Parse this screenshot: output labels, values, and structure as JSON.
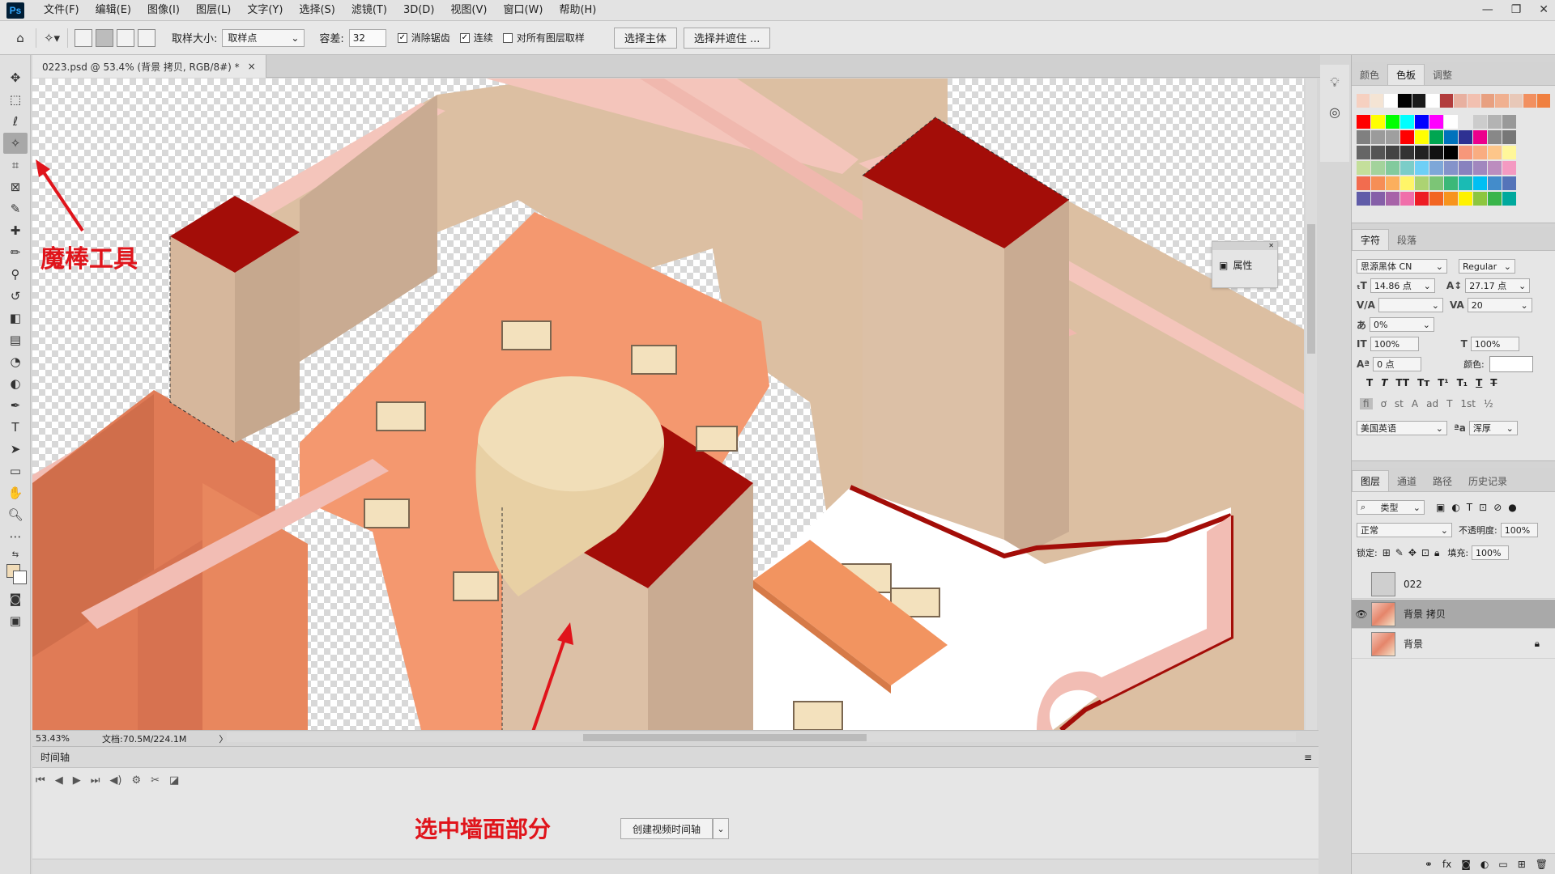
{
  "menubar": {
    "logo": "Ps",
    "items": [
      "文件(F)",
      "编辑(E)",
      "图像(I)",
      "图层(L)",
      "文字(Y)",
      "选择(S)",
      "滤镜(T)",
      "3D(D)",
      "视图(V)",
      "窗口(W)",
      "帮助(H)"
    ],
    "window_controls": [
      "—",
      "❐",
      "✕"
    ]
  },
  "optionsbar": {
    "sample_size_label": "取样大小:",
    "sample_size_value": "取样点",
    "tolerance_label": "容差:",
    "tolerance_value": "32",
    "antialias_label": "消除锯齿",
    "antialias_checked": true,
    "contiguous_label": "连续",
    "contiguous_checked": true,
    "all_layers_label": "对所有图层取样",
    "all_layers_checked": false,
    "select_subject": "选择主体",
    "select_and_mask": "选择并遮住 ..."
  },
  "document": {
    "tab_title": "0223.psd @ 53.4% (背景 拷贝, RGB/8#) *",
    "close": "×",
    "zoom": "53.43%",
    "doc_size": "文档:70.5M/224.1M",
    "arrow": "〉"
  },
  "timeline": {
    "title": "时间轴",
    "create_button": "创建视频时间轴",
    "controls": [
      "⏮",
      "◀",
      "▶",
      "⏭",
      "◀)",
      "⚙",
      "✂",
      "◪"
    ]
  },
  "properties_panel": {
    "label": "属性"
  },
  "swatches": {
    "tabs": [
      "颜色",
      "色板",
      "调整"
    ],
    "active_tab": "色板",
    "rows": [
      [
        "#f6d0c0",
        "#f4e4d4",
        "#ffffff",
        "#000000",
        "#1a1a1a",
        "#ffffff",
        "#b23c3c",
        "#e8b0a0",
        "#f2c0b0",
        "#e8a080",
        "#f0b090",
        "#e8c8b8",
        "#f29060",
        "#f08040"
      ],
      [
        "#ff0000",
        "#ffff00",
        "#00ff00",
        "#00ffff",
        "#0000ff",
        "#ff00ff",
        "#ffffff",
        "#e6e6e6",
        "#cccccc",
        "#b3b3b3",
        "#999999"
      ],
      [
        "#808080",
        "#9b9b9b",
        "#9f9f9f",
        "#ff0000",
        "#ffff00",
        "#00a651",
        "#0072bc",
        "#2e3192",
        "#ec008c",
        "#888888",
        "#777777"
      ],
      [
        "#666666",
        "#555555",
        "#444444",
        "#333333",
        "#222222",
        "#111111",
        "#000000",
        "#f7977a",
        "#f9ad81",
        "#fdc68a",
        "#fff79a"
      ],
      [
        "#c4df9b",
        "#a3d39c",
        "#82ca9d",
        "#7bcdc8",
        "#6ecff6",
        "#7ea7d8",
        "#8493ca",
        "#8882be",
        "#a187be",
        "#bc8dbf",
        "#f49ac2"
      ],
      [
        "#f26c4f",
        "#f68e56",
        "#fbaf5d",
        "#fff568",
        "#acd372",
        "#7cc576",
        "#3bb878",
        "#1abbb4",
        "#00bff3",
        "#438ccb",
        "#5574b9"
      ],
      [
        "#605ca8",
        "#855fa8",
        "#a763a8",
        "#f06eaa",
        "#ed1c24",
        "#f26522",
        "#f7941d",
        "#fff200",
        "#8dc63f",
        "#39b54a",
        "#00a99d"
      ]
    ]
  },
  "character": {
    "tabs": [
      "字符",
      "段落"
    ],
    "font_family": "思源黑体 CN",
    "font_style": "Regular",
    "font_size": "14.86 点",
    "leading": "27.17 点",
    "kerning": "",
    "tracking": "20",
    "scale_pct": "0%",
    "vertical_scale": "100%",
    "horizontal_scale": "100%",
    "baseline": "0 点",
    "color_label": "颜色:",
    "language": "美国英语",
    "antialias": "浑厚",
    "style_buttons": [
      "T",
      "T",
      "TT",
      "Tт",
      "T¹",
      "T₁",
      "T",
      "T"
    ],
    "opentype_buttons": [
      "ﬁ",
      "ơ",
      "st",
      "A",
      "ad",
      "T",
      "1st",
      "½"
    ]
  },
  "layers": {
    "tabs": [
      "图层",
      "通道",
      "路径",
      "历史记录"
    ],
    "filter": "类型",
    "blend_mode": "正常",
    "opacity_label": "不透明度:",
    "opacity_value": "100%",
    "lock_label": "锁定:",
    "fill_label": "填充:",
    "fill_value": "100%",
    "items": [
      {
        "name": "022",
        "visible": false,
        "selected": false
      },
      {
        "name": "背景 拷贝",
        "visible": true,
        "selected": true
      },
      {
        "name": "背景",
        "visible": false,
        "selected": false,
        "locked": true
      }
    ],
    "footer_icons": [
      "link-icon",
      "fx-icon",
      "mask-icon",
      "adjustment-icon",
      "folder-icon",
      "new-layer-icon",
      "trash-icon"
    ]
  },
  "annotations": {
    "magic_wand": "魔棒工具",
    "select_wall": "选中墙面部分"
  },
  "colors": {
    "annotation_red": "#e0141b",
    "wall_top_red": "#a30d08",
    "floor_orange": "#f4986f",
    "wall_beige": "#dec0a4",
    "wall_pink": "#f2bdb4"
  }
}
